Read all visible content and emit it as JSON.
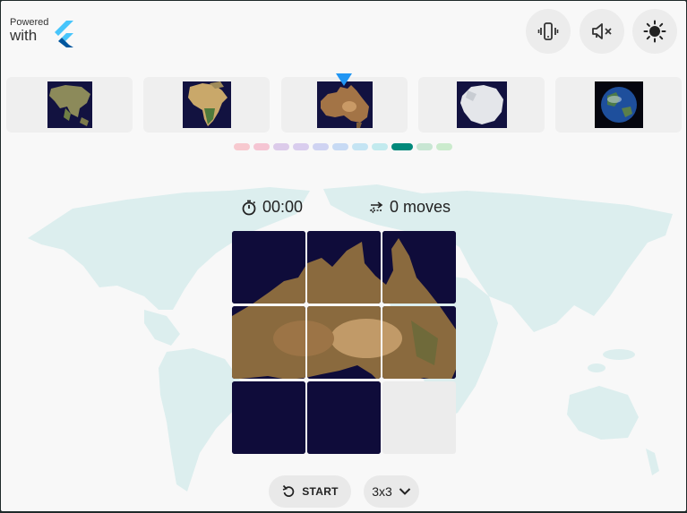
{
  "branding": {
    "powered_line": "Powered",
    "with_line": "with",
    "logo_icon": "flutter-logo-icon"
  },
  "toolbar": {
    "buttons": [
      {
        "name": "vibration-button",
        "icon": "vibration-phone-icon"
      },
      {
        "name": "sound-off-button",
        "icon": "speaker-muted-icon"
      },
      {
        "name": "theme-toggle-button",
        "icon": "sun-icon"
      }
    ]
  },
  "puzzles": {
    "items": [
      {
        "name": "asia",
        "icon": "asia-map-icon"
      },
      {
        "name": "africa",
        "icon": "africa-map-icon"
      },
      {
        "name": "australia",
        "icon": "australia-map-icon",
        "selected": true
      },
      {
        "name": "antarctica",
        "icon": "antarctica-map-icon"
      },
      {
        "name": "earth",
        "icon": "earth-globe-icon"
      }
    ]
  },
  "pager": {
    "colors": [
      "#f7c9cf",
      "#f5c5d3",
      "#dccbea",
      "#d9cdee",
      "#cfd3f2",
      "#c7daf4",
      "#c4e4f3",
      "#c2eaee",
      "#00897b",
      "#c8e6d3",
      "#cbebcd"
    ],
    "active_index": 8
  },
  "stats": {
    "time": "00:00",
    "moves": "0 moves"
  },
  "board": {
    "size": "3x3",
    "tiles": [
      1,
      2,
      3,
      4,
      5,
      6,
      7,
      8
    ],
    "empty_slot": 9
  },
  "controls": {
    "start_label": "START",
    "size_label": "3x3"
  },
  "colors": {
    "accent": "#00897b",
    "marker": "#2196f3",
    "ocean": "#0f0c3a"
  }
}
